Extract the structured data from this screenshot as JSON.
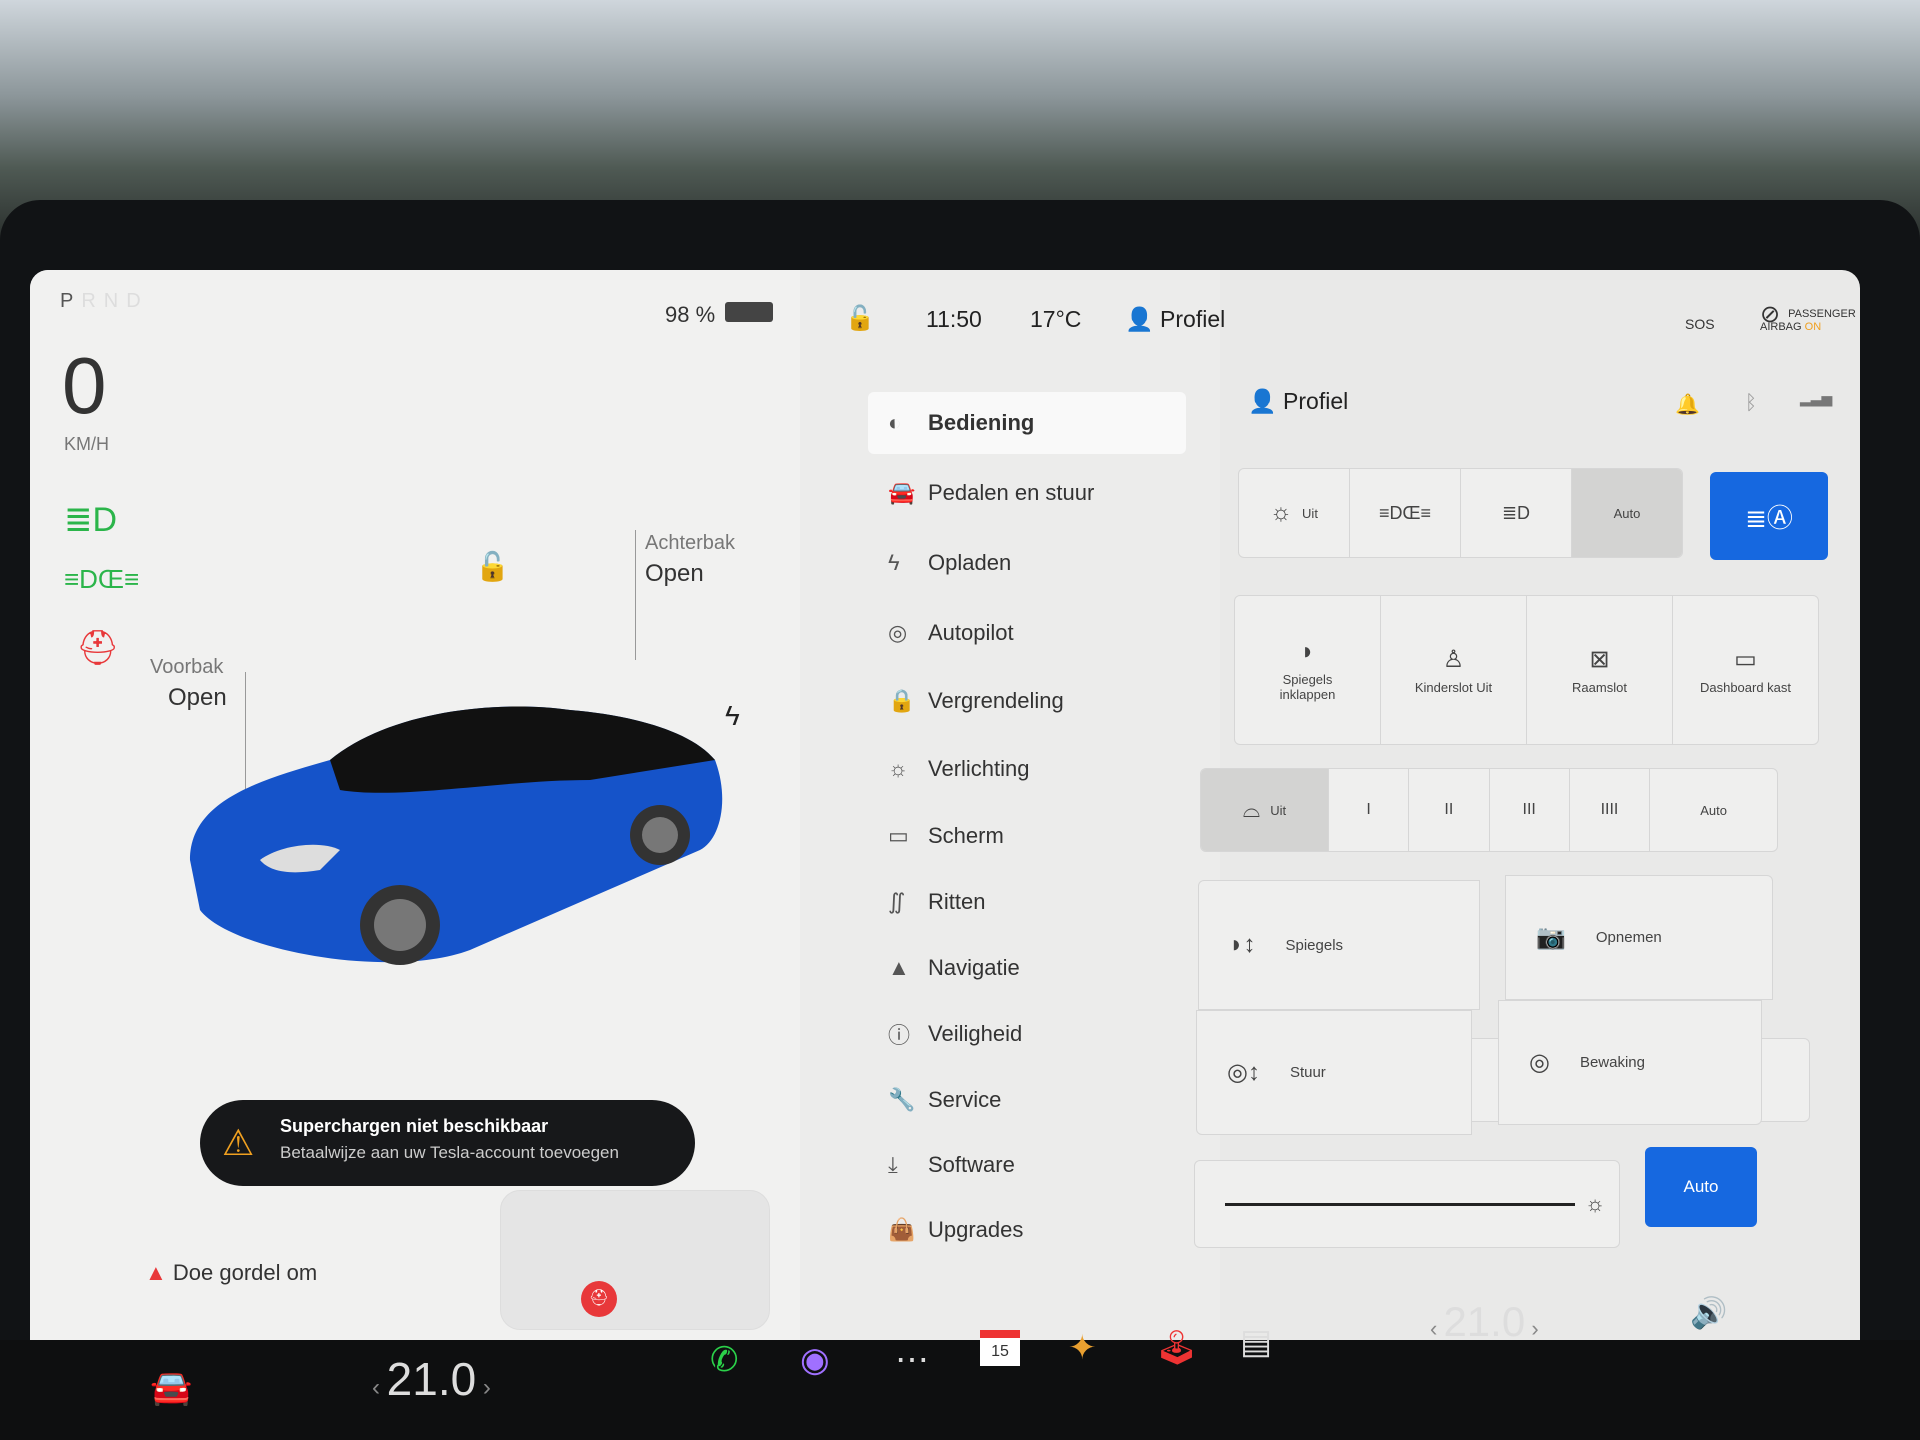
{
  "status": {
    "gear": [
      "P",
      "R",
      "N",
      "D"
    ],
    "active_gear": "P",
    "speed": "0",
    "speed_unit": "KM/H",
    "battery": "98 %",
    "battery_level": 98,
    "time": "11:50",
    "temperature": "17°C",
    "profile": "Profiel",
    "sos": "SOS",
    "airbag_line1": "PASSENGER",
    "airbag_line2": "AIRBAG",
    "airbag_state": "ON"
  },
  "car": {
    "frunk_label": "Voorbak",
    "frunk_state": "Open",
    "trunk_label": "Achterbak",
    "trunk_state": "Open",
    "body_color": "#1553c9"
  },
  "toast": {
    "title": "Superchargen niet beschikbaar",
    "message": "Betaalwijze aan uw Tesla-account toevoegen"
  },
  "seatbelt_warning": "Doe gordel om",
  "menu": [
    {
      "label": "Bediening",
      "icon": "toggle-icon"
    },
    {
      "label": "Pedalen en stuur",
      "icon": "car-icon"
    },
    {
      "label": "Opladen",
      "icon": "bolt-icon"
    },
    {
      "label": "Autopilot",
      "icon": "steering-wheel-icon"
    },
    {
      "label": "Vergrendeling",
      "icon": "lock-icon"
    },
    {
      "label": "Verlichting",
      "icon": "light-icon"
    },
    {
      "label": "Scherm",
      "icon": "display-icon"
    },
    {
      "label": "Ritten",
      "icon": "trips-icon"
    },
    {
      "label": "Navigatie",
      "icon": "navigation-icon"
    },
    {
      "label": "Veiligheid",
      "icon": "safety-icon"
    },
    {
      "label": "Service",
      "icon": "wrench-icon"
    },
    {
      "label": "Software",
      "icon": "download-icon"
    },
    {
      "label": "Upgrades",
      "icon": "bag-icon"
    }
  ],
  "panel": {
    "profile": "Profiel",
    "lights": [
      {
        "label": "Uit"
      },
      {
        "label": ""
      },
      {
        "label": ""
      },
      {
        "label": "Auto"
      }
    ],
    "quick": [
      {
        "label": "Spiegels inklappen"
      },
      {
        "label": "Kinderslot Uit"
      },
      {
        "label": "Raamslot"
      },
      {
        "label": "Dashboard kast"
      }
    ],
    "wipers": [
      "Uit",
      "I",
      "II",
      "III",
      "IIII",
      "Auto"
    ],
    "adjust": [
      {
        "label": "Spiegels"
      },
      {
        "label": "Opnemen"
      },
      {
        "label": "Stuur"
      },
      {
        "label": "Bewaking"
      }
    ],
    "brightness_auto": "Auto",
    "brightness_level": 100,
    "accent": "#1668e0"
  },
  "bottom": {
    "driver_temp": "21.0",
    "passenger_temp": "21.0",
    "calendar_day": "15"
  }
}
